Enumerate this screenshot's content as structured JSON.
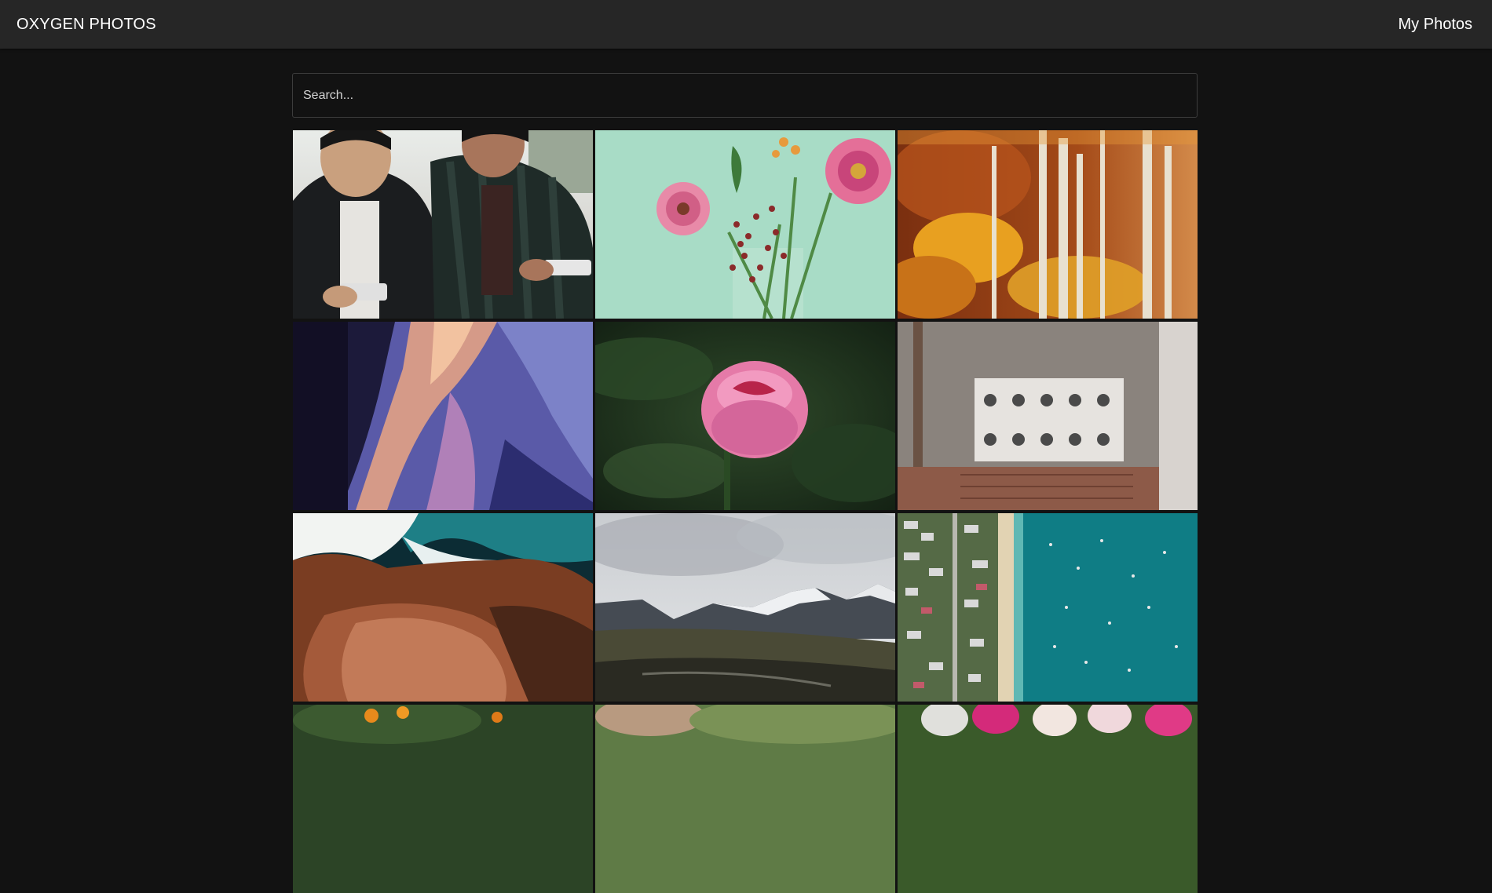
{
  "header": {
    "brand": "OXYGEN PHOTOS",
    "nav_link": "My Photos"
  },
  "search": {
    "placeholder": "Search...",
    "value": ""
  },
  "photos": [
    {
      "id": "gamers"
    },
    {
      "id": "pink-gerbera-flowers"
    },
    {
      "id": "autumn-aspen-forest"
    },
    {
      "id": "canyon-sandstone"
    },
    {
      "id": "pink-peony"
    },
    {
      "id": "wall-switches"
    },
    {
      "id": "coastal-rocks"
    },
    {
      "id": "snowy-mountains"
    },
    {
      "id": "aerial-beach-town"
    },
    {
      "id": "orange-tree"
    },
    {
      "id": "green-blur"
    },
    {
      "id": "tulips"
    }
  ],
  "colors": {
    "topbar_bg": "#262626",
    "page_bg": "#121212",
    "text": "#ffffff"
  }
}
